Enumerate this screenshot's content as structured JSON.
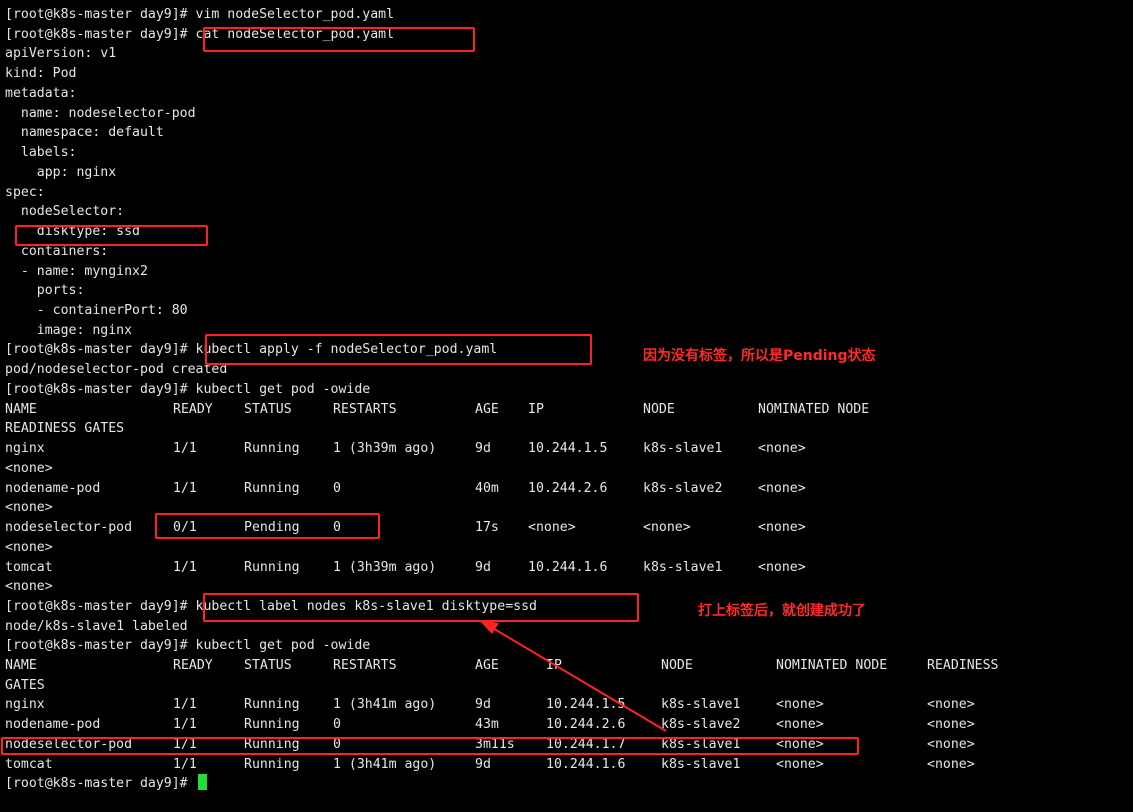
{
  "terminal": {
    "lines": [
      "[root@k8s-master day9]# vim nodeSelector_pod.yaml",
      "[root@k8s-master day9]# cat nodeSelector_pod.yaml",
      "apiVersion: v1",
      "kind: Pod",
      "metadata:",
      "  name: nodeselector-pod",
      "  namespace: default",
      "  labels:",
      "    app: nginx",
      "spec:",
      "  nodeSelector:",
      "    disktype: ssd",
      "  containers:",
      "  - name: mynginx2",
      "    ports:",
      "    - containerPort: 80",
      "    image: nginx",
      "[root@k8s-master day9]# kubectl apply -f nodeSelector_pod.yaml",
      "pod/nodeselector-pod created",
      "[root@k8s-master day9]# kubectl get pod -owide"
    ],
    "table1": {
      "headers": [
        "NAME",
        "READY",
        "STATUS",
        "RESTARTS",
        "AGE",
        "IP",
        "NODE",
        "NOMINATED NODE"
      ],
      "header_wrap": "READINESS GATES",
      "rows": [
        {
          "cells": [
            "nginx",
            "1/1",
            "Running",
            "1 (3h39m ago)",
            "9d",
            "10.244.1.5",
            "k8s-slave1",
            "<none>"
          ],
          "wrap": "<none>"
        },
        {
          "cells": [
            "nodename-pod",
            "1/1",
            "Running",
            "0",
            "40m",
            "10.244.2.6",
            "k8s-slave2",
            "<none>"
          ],
          "wrap": "<none>"
        },
        {
          "cells": [
            "nodeselector-pod",
            "0/1",
            "Pending",
            "0",
            "17s",
            "<none>",
            "<none>",
            "<none>"
          ],
          "wrap": "<none>"
        },
        {
          "cells": [
            "tomcat",
            "1/1",
            "Running",
            "1 (3h39m ago)",
            "9d",
            "10.244.1.6",
            "k8s-slave1",
            "<none>"
          ],
          "wrap": "<none>"
        }
      ]
    },
    "lines2": [
      "[root@k8s-master day9]# kubectl label nodes k8s-slave1 disktype=ssd",
      "node/k8s-slave1 labeled",
      "[root@k8s-master day9]# kubectl get pod -owide"
    ],
    "table2": {
      "headers": [
        "NAME",
        "READY",
        "STATUS",
        "RESTARTS",
        "AGE",
        "IP",
        "NODE",
        "NOMINATED NODE",
        "READINESS"
      ],
      "header_wrap": "GATES",
      "rows": [
        [
          "nginx",
          "1/1",
          "Running",
          "1 (3h41m ago)",
          "9d",
          "10.244.1.5",
          "k8s-slave1",
          "<none>",
          "<none>"
        ],
        [
          "nodename-pod",
          "1/1",
          "Running",
          "0",
          "43m",
          "10.244.2.6",
          "k8s-slave2",
          "<none>",
          "<none>"
        ],
        [
          "nodeselector-pod",
          "1/1",
          "Running",
          "0",
          "3m11s",
          "10.244.1.7",
          "k8s-slave1",
          "<none>",
          "<none>"
        ],
        [
          "tomcat",
          "1/1",
          "Running",
          "1 (3h41m ago)",
          "9d",
          "10.244.1.6",
          "k8s-slave1",
          "<none>",
          "<none>"
        ]
      ]
    },
    "final_prompt": "[root@k8s-master day9]# "
  },
  "annotations": {
    "pending_note": "因为没有标签，所以是Pending状态",
    "success_note": "打上标签后，就创建成功了"
  },
  "colors": {
    "background": "#000000",
    "text": "#e6e6e6",
    "highlight": "#ff2222",
    "note": "#ff2a2a",
    "cursor": "#22dd33"
  }
}
